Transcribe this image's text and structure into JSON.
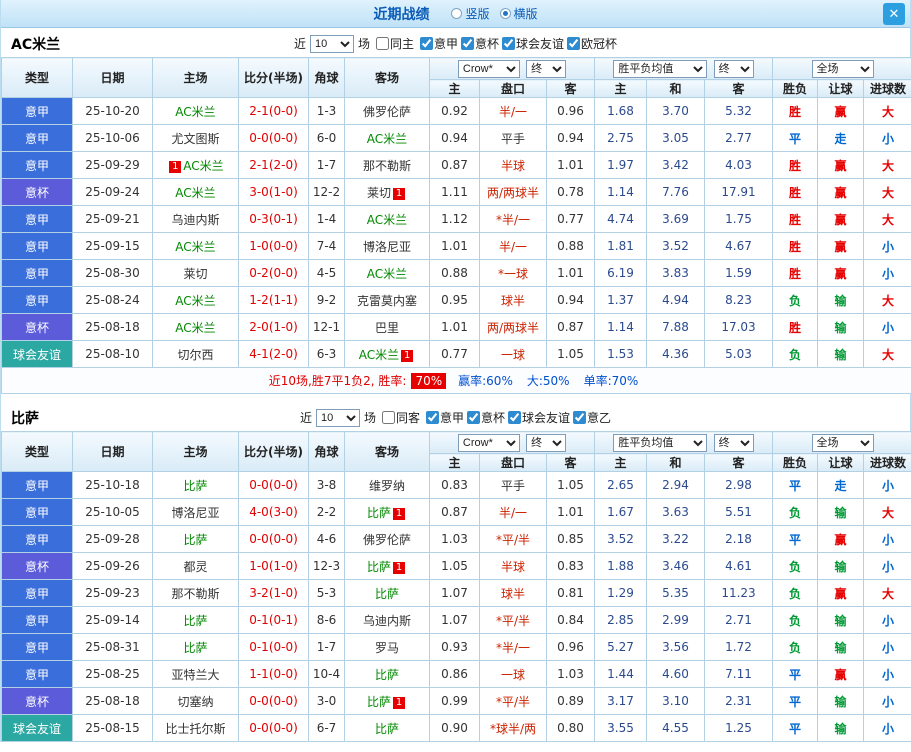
{
  "titlebar": {
    "title": "近期战绩",
    "layout_options": [
      {
        "label": "竖版",
        "selected": false
      },
      {
        "label": "横版",
        "selected": true
      }
    ],
    "close_glyph": "✕"
  },
  "filter_labels": {
    "recent": "近",
    "games": "场"
  },
  "table_headers": {
    "type": "类型",
    "date": "日期",
    "home": "主场",
    "score": "比分(半场)",
    "corner": "角球",
    "away": "客场",
    "bookmaker_select": "Crow*",
    "final_select": "终",
    "avg_select": "胜平负均值",
    "final_select2": "终",
    "scope_select": "全场",
    "ah_home": "主",
    "ah_handicap": "盘口",
    "ah_away": "客",
    "o_home": "主",
    "o_draw": "和",
    "o_away": "客",
    "result": "胜负",
    "handicap_result": "让球",
    "goals": "进球数"
  },
  "league_colors": {
    "意甲": "#3a6edb",
    "意杯": "#5c5cdb",
    "球会友谊": "#2ca8a2",
    "意乙": "#3a6edb"
  },
  "result_colors": {
    "胜": "#e60000",
    "赢": "#e60000",
    "大": "#e60000",
    "平": "#0066d0",
    "走": "#0066d0",
    "小": "#0066d0",
    "负": "#009933",
    "输": "#009933"
  },
  "sections": [
    {
      "team": "AC米兰",
      "filter": {
        "count": "10",
        "same_venue": {
          "label": "同主",
          "checked": false
        },
        "leagues": [
          {
            "label": "意甲",
            "checked": true
          },
          {
            "label": "意杯",
            "checked": true
          },
          {
            "label": "球会友谊",
            "checked": true
          },
          {
            "label": "欧冠杯",
            "checked": true
          }
        ]
      },
      "rows": [
        {
          "league": "意甲",
          "date": "25-10-20",
          "home": "AC米兰",
          "home_focus": true,
          "home_badge": "",
          "score": "2-1(0-0)",
          "corner": "1-3",
          "away": "佛罗伦萨",
          "away_focus": false,
          "away_badge": "",
          "ah_home": "0.92",
          "handicap": "半/一",
          "ah_away": "0.96",
          "o_home": "1.68",
          "o_draw": "3.70",
          "o_away": "5.32",
          "result": "胜",
          "h_result": "赢",
          "g_result": "大"
        },
        {
          "league": "意甲",
          "date": "25-10-06",
          "home": "尤文图斯",
          "home_focus": false,
          "home_badge": "",
          "score": "0-0(0-0)",
          "corner": "6-0",
          "away": "AC米兰",
          "away_focus": true,
          "away_badge": "",
          "ah_home": "0.94",
          "handicap": "平手",
          "ah_away": "0.94",
          "o_home": "2.75",
          "o_draw": "3.05",
          "o_away": "2.77",
          "result": "平",
          "h_result": "走",
          "g_result": "小"
        },
        {
          "league": "意甲",
          "date": "25-09-29",
          "home": "AC米兰",
          "home_focus": true,
          "home_badge": "1",
          "score": "2-1(2-0)",
          "corner": "1-7",
          "away": "那不勒斯",
          "away_focus": false,
          "away_badge": "",
          "ah_home": "0.87",
          "handicap": "半球",
          "ah_away": "1.01",
          "o_home": "1.97",
          "o_draw": "3.42",
          "o_away": "4.03",
          "result": "胜",
          "h_result": "赢",
          "g_result": "大"
        },
        {
          "league": "意杯",
          "date": "25-09-24",
          "home": "AC米兰",
          "home_focus": true,
          "home_badge": "",
          "score": "3-0(1-0)",
          "corner": "12-2",
          "away": "莱切",
          "away_focus": false,
          "away_badge": "1",
          "ah_home": "1.11",
          "handicap": "两/两球半",
          "ah_away": "0.78",
          "o_home": "1.14",
          "o_draw": "7.76",
          "o_away": "17.91",
          "result": "胜",
          "h_result": "赢",
          "g_result": "大"
        },
        {
          "league": "意甲",
          "date": "25-09-21",
          "home": "乌迪内斯",
          "home_focus": false,
          "home_badge": "",
          "score": "0-3(0-1)",
          "corner": "1-4",
          "away": "AC米兰",
          "away_focus": true,
          "away_badge": "",
          "ah_home": "1.12",
          "handicap": "*半/一",
          "ah_away": "0.77",
          "o_home": "4.74",
          "o_draw": "3.69",
          "o_away": "1.75",
          "result": "胜",
          "h_result": "赢",
          "g_result": "大"
        },
        {
          "league": "意甲",
          "date": "25-09-15",
          "home": "AC米兰",
          "home_focus": true,
          "home_badge": "",
          "score": "1-0(0-0)",
          "corner": "7-4",
          "away": "博洛尼亚",
          "away_focus": false,
          "away_badge": "",
          "ah_home": "1.01",
          "handicap": "半/一",
          "ah_away": "0.88",
          "o_home": "1.81",
          "o_draw": "3.52",
          "o_away": "4.67",
          "result": "胜",
          "h_result": "赢",
          "g_result": "小"
        },
        {
          "league": "意甲",
          "date": "25-08-30",
          "home": "莱切",
          "home_focus": false,
          "home_badge": "",
          "score": "0-2(0-0)",
          "corner": "4-5",
          "away": "AC米兰",
          "away_focus": true,
          "away_badge": "",
          "ah_home": "0.88",
          "handicap": "*一球",
          "ah_away": "1.01",
          "o_home": "6.19",
          "o_draw": "3.83",
          "o_away": "1.59",
          "result": "胜",
          "h_result": "赢",
          "g_result": "小"
        },
        {
          "league": "意甲",
          "date": "25-08-24",
          "home": "AC米兰",
          "home_focus": true,
          "home_badge": "",
          "score": "1-2(1-1)",
          "corner": "9-2",
          "away": "克雷莫内塞",
          "away_focus": false,
          "away_badge": "",
          "ah_home": "0.95",
          "handicap": "球半",
          "ah_away": "0.94",
          "o_home": "1.37",
          "o_draw": "4.94",
          "o_away": "8.23",
          "result": "负",
          "h_result": "输",
          "g_result": "大"
        },
        {
          "league": "意杯",
          "date": "25-08-18",
          "home": "AC米兰",
          "home_focus": true,
          "home_badge": "",
          "score": "2-0(1-0)",
          "corner": "12-1",
          "away": "巴里",
          "away_focus": false,
          "away_badge": "",
          "ah_home": "1.01",
          "handicap": "两/两球半",
          "ah_away": "0.87",
          "o_home": "1.14",
          "o_draw": "7.88",
          "o_away": "17.03",
          "result": "胜",
          "h_result": "输",
          "g_result": "小"
        },
        {
          "league": "球会友谊",
          "date": "25-08-10",
          "home": "切尔西",
          "home_focus": false,
          "home_badge": "",
          "score": "4-1(2-0)",
          "corner": "6-3",
          "away": "AC米兰",
          "away_focus": true,
          "away_badge": "1",
          "ah_home": "0.77",
          "handicap": "一球",
          "ah_away": "1.05",
          "o_home": "1.53",
          "o_draw": "4.36",
          "o_away": "5.03",
          "result": "负",
          "h_result": "输",
          "g_result": "大"
        }
      ],
      "summary": {
        "prefix": "近10场,胜7平1负2, 胜率:",
        "rate": "70%",
        "stats": [
          "赢率:60%",
          "大:50%",
          "单率:70%"
        ]
      }
    },
    {
      "team": "比萨",
      "filter": {
        "count": "10",
        "same_venue": {
          "label": "同客",
          "checked": false
        },
        "leagues": [
          {
            "label": "意甲",
            "checked": true
          },
          {
            "label": "意杯",
            "checked": true
          },
          {
            "label": "球会友谊",
            "checked": true
          },
          {
            "label": "意乙",
            "checked": true
          }
        ]
      },
      "rows": [
        {
          "league": "意甲",
          "date": "25-10-18",
          "home": "比萨",
          "home_focus": true,
          "home_badge": "",
          "score": "0-0(0-0)",
          "corner": "3-8",
          "away": "维罗纳",
          "away_focus": false,
          "away_badge": "",
          "ah_home": "0.83",
          "handicap": "平手",
          "ah_away": "1.05",
          "o_home": "2.65",
          "o_draw": "2.94",
          "o_away": "2.98",
          "result": "平",
          "h_result": "走",
          "g_result": "小"
        },
        {
          "league": "意甲",
          "date": "25-10-05",
          "home": "博洛尼亚",
          "home_focus": false,
          "home_badge": "",
          "score": "4-0(3-0)",
          "corner": "2-2",
          "away": "比萨",
          "away_focus": true,
          "away_badge": "1",
          "ah_home": "0.87",
          "handicap": "半/一",
          "ah_away": "1.01",
          "o_home": "1.67",
          "o_draw": "3.63",
          "o_away": "5.51",
          "result": "负",
          "h_result": "输",
          "g_result": "大"
        },
        {
          "league": "意甲",
          "date": "25-09-28",
          "home": "比萨",
          "home_focus": true,
          "home_badge": "",
          "score": "0-0(0-0)",
          "corner": "4-6",
          "away": "佛罗伦萨",
          "away_focus": false,
          "away_badge": "",
          "ah_home": "1.03",
          "handicap": "*平/半",
          "ah_away": "0.85",
          "o_home": "3.52",
          "o_draw": "3.22",
          "o_away": "2.18",
          "result": "平",
          "h_result": "赢",
          "g_result": "小"
        },
        {
          "league": "意杯",
          "date": "25-09-26",
          "home": "都灵",
          "home_focus": false,
          "home_badge": "",
          "score": "1-0(1-0)",
          "corner": "12-3",
          "away": "比萨",
          "away_focus": true,
          "away_badge": "1",
          "ah_home": "1.05",
          "handicap": "半球",
          "ah_away": "0.83",
          "o_home": "1.88",
          "o_draw": "3.46",
          "o_away": "4.61",
          "result": "负",
          "h_result": "输",
          "g_result": "小"
        },
        {
          "league": "意甲",
          "date": "25-09-23",
          "home": "那不勒斯",
          "home_focus": false,
          "home_badge": "",
          "score": "3-2(1-0)",
          "corner": "5-3",
          "away": "比萨",
          "away_focus": true,
          "away_badge": "",
          "ah_home": "1.07",
          "handicap": "球半",
          "ah_away": "0.81",
          "o_home": "1.29",
          "o_draw": "5.35",
          "o_away": "11.23",
          "result": "负",
          "h_result": "赢",
          "g_result": "大"
        },
        {
          "league": "意甲",
          "date": "25-09-14",
          "home": "比萨",
          "home_focus": true,
          "home_badge": "",
          "score": "0-1(0-1)",
          "corner": "8-6",
          "away": "乌迪内斯",
          "away_focus": false,
          "away_badge": "",
          "ah_home": "1.07",
          "handicap": "*平/半",
          "ah_away": "0.84",
          "o_home": "2.85",
          "o_draw": "2.99",
          "o_away": "2.71",
          "result": "负",
          "h_result": "输",
          "g_result": "小"
        },
        {
          "league": "意甲",
          "date": "25-08-31",
          "home": "比萨",
          "home_focus": true,
          "home_badge": "",
          "score": "0-1(0-0)",
          "corner": "1-7",
          "away": "罗马",
          "away_focus": false,
          "away_badge": "",
          "ah_home": "0.93",
          "handicap": "*半/一",
          "ah_away": "0.96",
          "o_home": "5.27",
          "o_draw": "3.56",
          "o_away": "1.72",
          "result": "负",
          "h_result": "输",
          "g_result": "小"
        },
        {
          "league": "意甲",
          "date": "25-08-25",
          "home": "亚特兰大",
          "home_focus": false,
          "home_badge": "",
          "score": "1-1(0-0)",
          "corner": "10-4",
          "away": "比萨",
          "away_focus": true,
          "away_badge": "",
          "ah_home": "0.86",
          "handicap": "一球",
          "ah_away": "1.03",
          "o_home": "1.44",
          "o_draw": "4.60",
          "o_away": "7.11",
          "result": "平",
          "h_result": "赢",
          "g_result": "小"
        },
        {
          "league": "意杯",
          "date": "25-08-18",
          "home": "切塞纳",
          "home_focus": false,
          "home_badge": "",
          "score": "0-0(0-0)",
          "corner": "3-0",
          "away": "比萨",
          "away_focus": true,
          "away_badge": "1",
          "ah_home": "0.99",
          "handicap": "*平/半",
          "ah_away": "0.89",
          "o_home": "3.17",
          "o_draw": "3.10",
          "o_away": "2.31",
          "result": "平",
          "h_result": "输",
          "g_result": "小"
        },
        {
          "league": "球会友谊",
          "date": "25-08-15",
          "home": "比士托尔斯",
          "home_focus": false,
          "home_badge": "",
          "score": "0-0(0-0)",
          "corner": "6-7",
          "away": "比萨",
          "away_focus": true,
          "away_badge": "",
          "ah_home": "0.90",
          "handicap": "*球半/两",
          "ah_away": "0.80",
          "o_home": "3.55",
          "o_draw": "4.55",
          "o_away": "1.25",
          "result": "平",
          "h_result": "输",
          "g_result": "小"
        }
      ],
      "summary": null
    }
  ]
}
